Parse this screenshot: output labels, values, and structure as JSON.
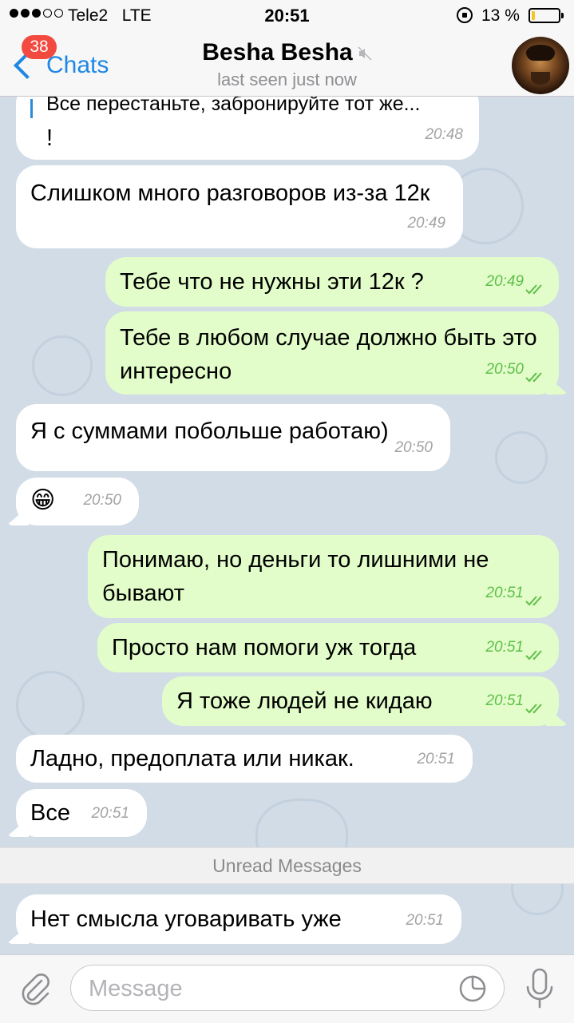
{
  "status_bar": {
    "carrier": "Tele2",
    "network": "LTE",
    "time": "20:51",
    "battery_percent": "13 %",
    "battery_level": 0.13,
    "signal_bars": 3
  },
  "header": {
    "back_label": "Chats",
    "unread_badge": "38",
    "title": "Besha Besha",
    "status": "last seen just now",
    "muted_icon": "speaker-mute-icon",
    "accent_color": "#1e88e5"
  },
  "messages": [
    {
      "dir": "in",
      "quote": "Все перестаньте, забронируйте тот же...",
      "text": "!",
      "time": "20:48"
    },
    {
      "dir": "in",
      "text": "Слишком много разговоров из-за 12к",
      "time": "20:49"
    },
    {
      "dir": "out",
      "text": "Тебе что не нужны эти 12к ?",
      "time": "20:49"
    },
    {
      "dir": "out",
      "text": "Тебе в любом случае должно быть это интересно",
      "time": "20:50"
    },
    {
      "dir": "in",
      "text": "Я с суммами побольше работаю)",
      "time": "20:50"
    },
    {
      "dir": "in",
      "text": "😁",
      "time": "20:50"
    },
    {
      "dir": "out",
      "text": "Понимаю, но деньги то лишними не бывают",
      "time": "20:51"
    },
    {
      "dir": "out",
      "text": "Просто нам помоги уж тогда",
      "time": "20:51"
    },
    {
      "dir": "out",
      "text": "Я тоже людей не кидаю",
      "time": "20:51"
    },
    {
      "dir": "in",
      "text": "Ладно, предоплата или никак.",
      "time": "20:51"
    },
    {
      "dir": "in",
      "text": "Все",
      "time": "20:51"
    },
    {
      "dir": "in",
      "text": "Нет смысла уговаривать уже",
      "time": "20:51"
    }
  ],
  "unread_divider": "Unread Messages",
  "input": {
    "placeholder": "Message",
    "value": ""
  },
  "colors": {
    "incoming_bubble": "#ffffff",
    "outgoing_bubble": "#e2fdc9",
    "read_checks": "#5fbf4a",
    "badge": "#f24a3f"
  }
}
